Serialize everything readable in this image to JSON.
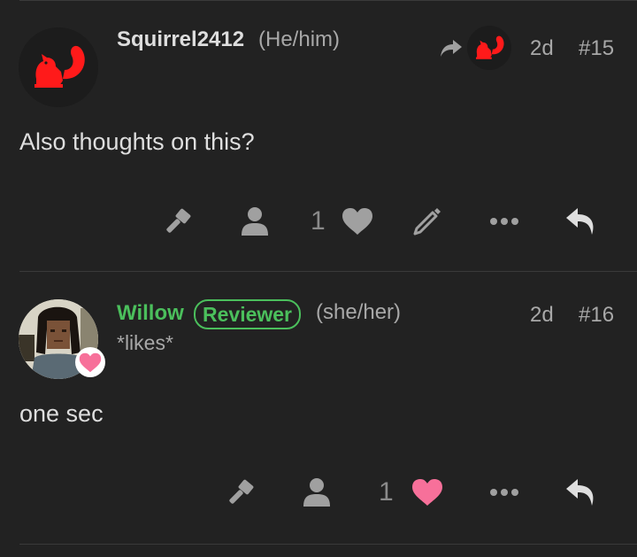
{
  "posts": [
    {
      "username": "Squirrel2412",
      "pronouns": "(He/him)",
      "age": "2d",
      "number": "#15",
      "body": "Also thoughts on this?",
      "likes": "1",
      "avatar_icon": "red-squirrel-icon",
      "like_color": "#a0a0a0"
    },
    {
      "username": "Willow",
      "badge": "Reviewer",
      "pronouns": "(she/her)",
      "subline": "*likes*",
      "age": "2d",
      "number": "#16",
      "body": "one sec",
      "likes": "1",
      "avatar_icon": "pixel-art-avatar",
      "like_color": "#f7709a"
    }
  ],
  "colors": {
    "background": "#222222",
    "username": "#dedede",
    "username_green": "#4bbf5c",
    "muted": "#a8a8a8",
    "icon": "#a0a0a0",
    "heart_liked": "#f7709a",
    "squirrel_red": "#ff1a1a"
  }
}
